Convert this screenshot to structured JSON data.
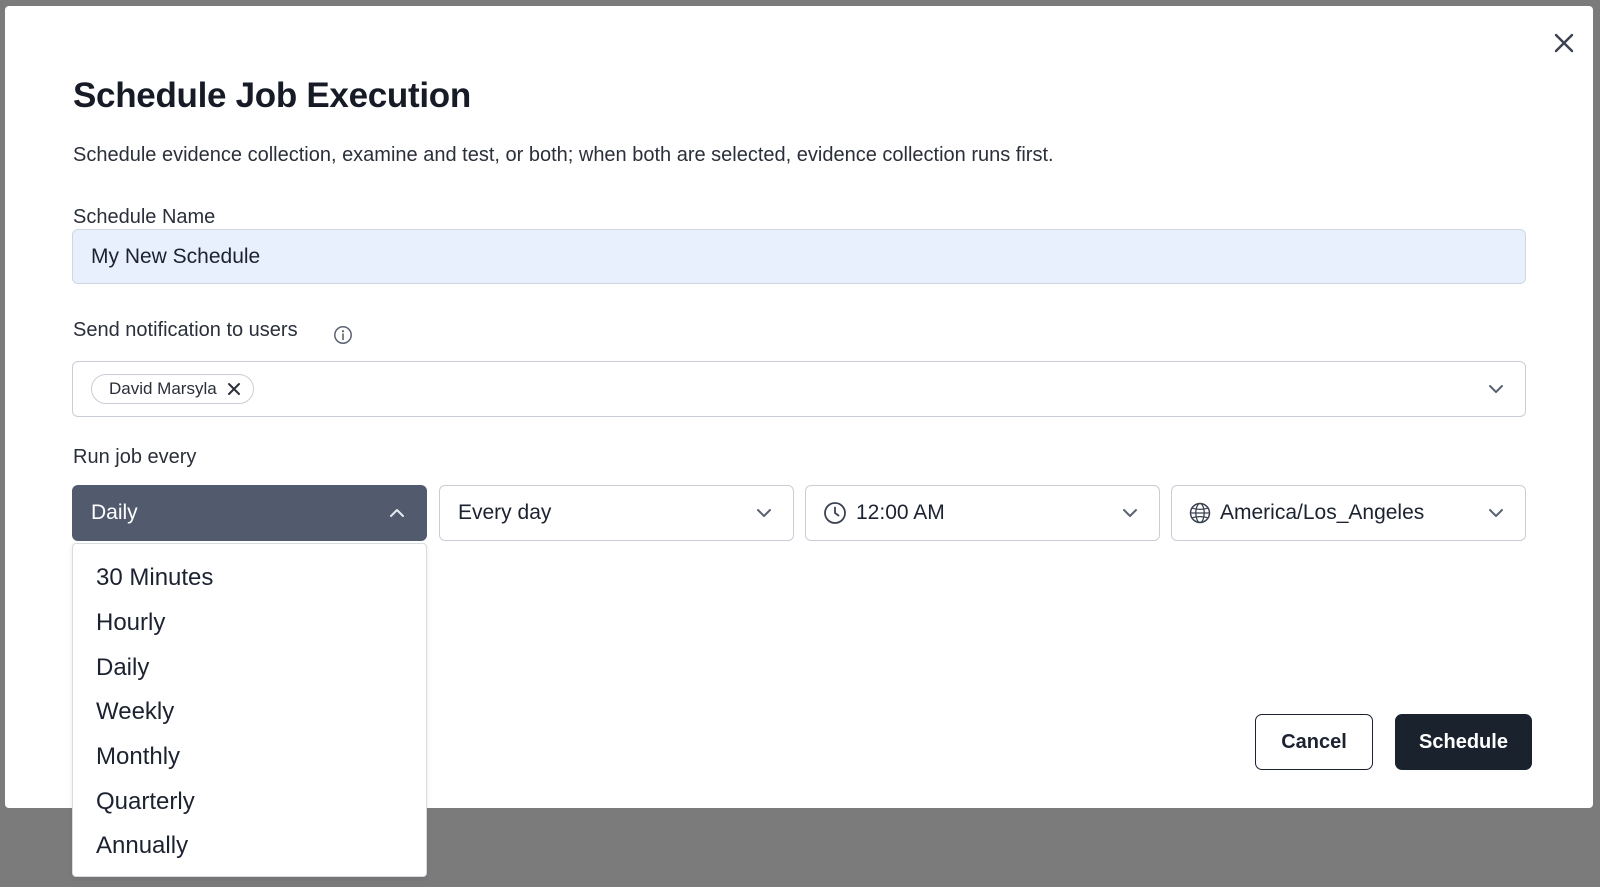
{
  "modal": {
    "title": "Schedule Job Execution",
    "description": "Schedule evidence collection, examine and test, or both; when both are selected, evidence collection runs first.",
    "close_icon": "close-icon"
  },
  "schedule_name": {
    "label": "Schedule Name",
    "value": "My New Schedule"
  },
  "notification": {
    "label": "Send notification to users",
    "info_icon": "info-icon",
    "selected_users": [
      "David Marsyla"
    ]
  },
  "run_job": {
    "label": "Run job every",
    "frequency": "Daily",
    "day_option": "Every day",
    "time": "12:00 AM",
    "timezone": "America/Los_Angeles",
    "frequency_options": [
      "30 Minutes",
      "Hourly",
      "Daily",
      "Weekly",
      "Monthly",
      "Quarterly",
      "Annually"
    ]
  },
  "actions": {
    "cancel_label": "Cancel",
    "schedule_label": "Schedule"
  },
  "colors": {
    "overlay": "#7b7b7b",
    "input_fill": "#e8f0fe",
    "active_select": "#525b6e",
    "primary_button": "#1a222e"
  }
}
